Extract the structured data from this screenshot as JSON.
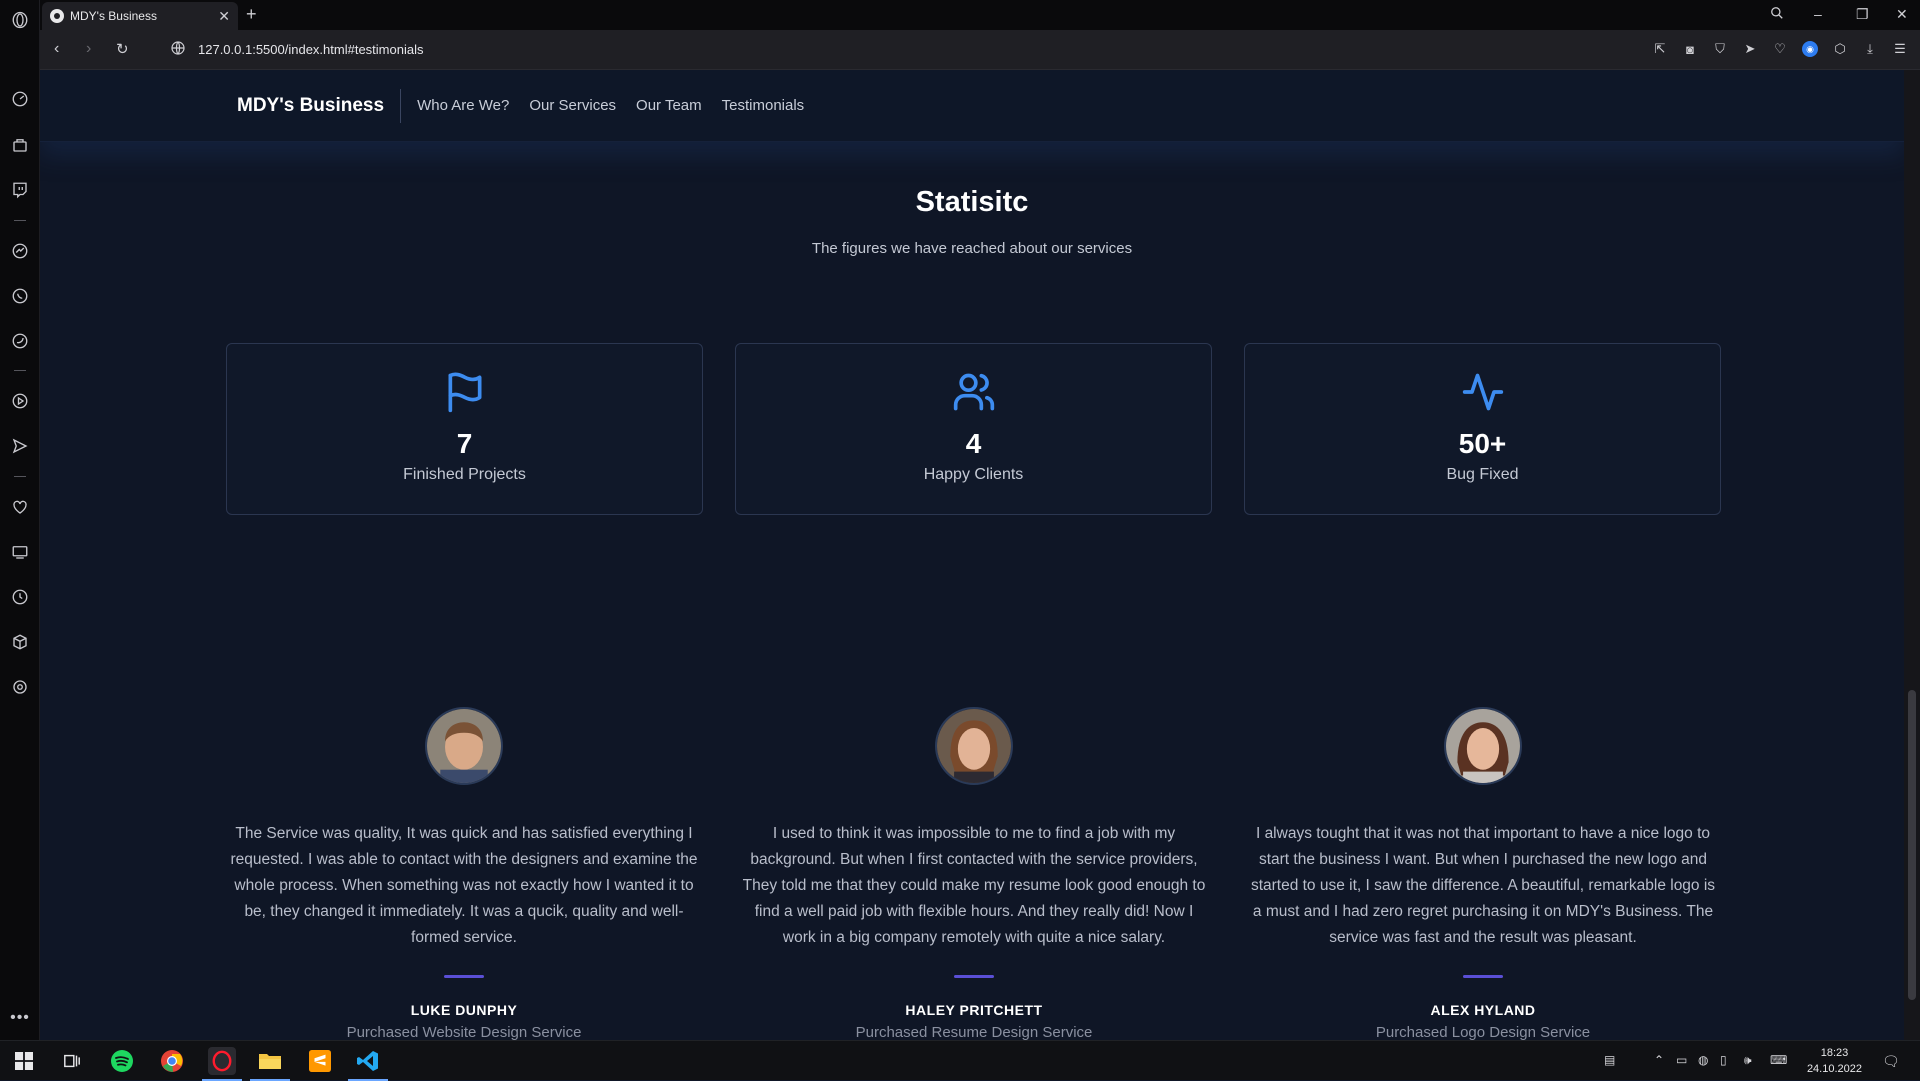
{
  "browser": {
    "tab_title": "MDY's Business",
    "url": "127.0.0.1:5500/index.html#testimonials",
    "new_tab_symbol": "+",
    "tab_close_symbol": "✕"
  },
  "site": {
    "brand": "MDY's Business",
    "nav": [
      {
        "label": "Who Are We?"
      },
      {
        "label": "Our Services"
      },
      {
        "label": "Our Team"
      },
      {
        "label": "Testimonials"
      }
    ]
  },
  "stats": {
    "title": "Statisitc",
    "subtitle": "The figures we have reached about our services",
    "cards": [
      {
        "icon": "flag-icon",
        "value": "7",
        "label": "Finished Projects"
      },
      {
        "icon": "users-icon",
        "value": "4",
        "label": "Happy Clients"
      },
      {
        "icon": "activity-icon",
        "value": "50+",
        "label": "Bug Fixed"
      }
    ]
  },
  "testimonials": [
    {
      "quote": "The Service was quality, It was quick and has satisfied everything I requested. I was able to contact with the designers and examine the whole process. When something was not exactly how I wanted it to be, they changed it immediately. It was a qucik, quality and well-formed service.",
      "name": "LUKE DUNPHY",
      "role": "Purchased Website Design Service"
    },
    {
      "quote": "I used to think it was impossible to me to find a job with my background. But when I first contacted with the service providers, They told me that they could make my resume look good enough to find a well paid job with flexible hours. And they really did! Now I work in a big company remotely with quite a nice salary.",
      "name": "HALEY PRITCHETT",
      "role": "Purchased Resume Design Service"
    },
    {
      "quote": "I always tought that it was not that important to have a nice logo to start the business I want. But when I purchased the new logo and started to use it, I saw the difference. A beautiful, remarkable logo is a must and I had zero regret purchasing it on MDY's Business. The service was fast and the result was pleasant.",
      "name": "ALEX HYLAND",
      "role": "Purchased Logo Design Service"
    }
  ],
  "taskbar": {
    "time": "18:23",
    "date": "24.10.2022"
  },
  "colors": {
    "page_bg": "#0f1626",
    "accent_icon": "#3d8cf0",
    "divider": "#5a4fd6"
  }
}
